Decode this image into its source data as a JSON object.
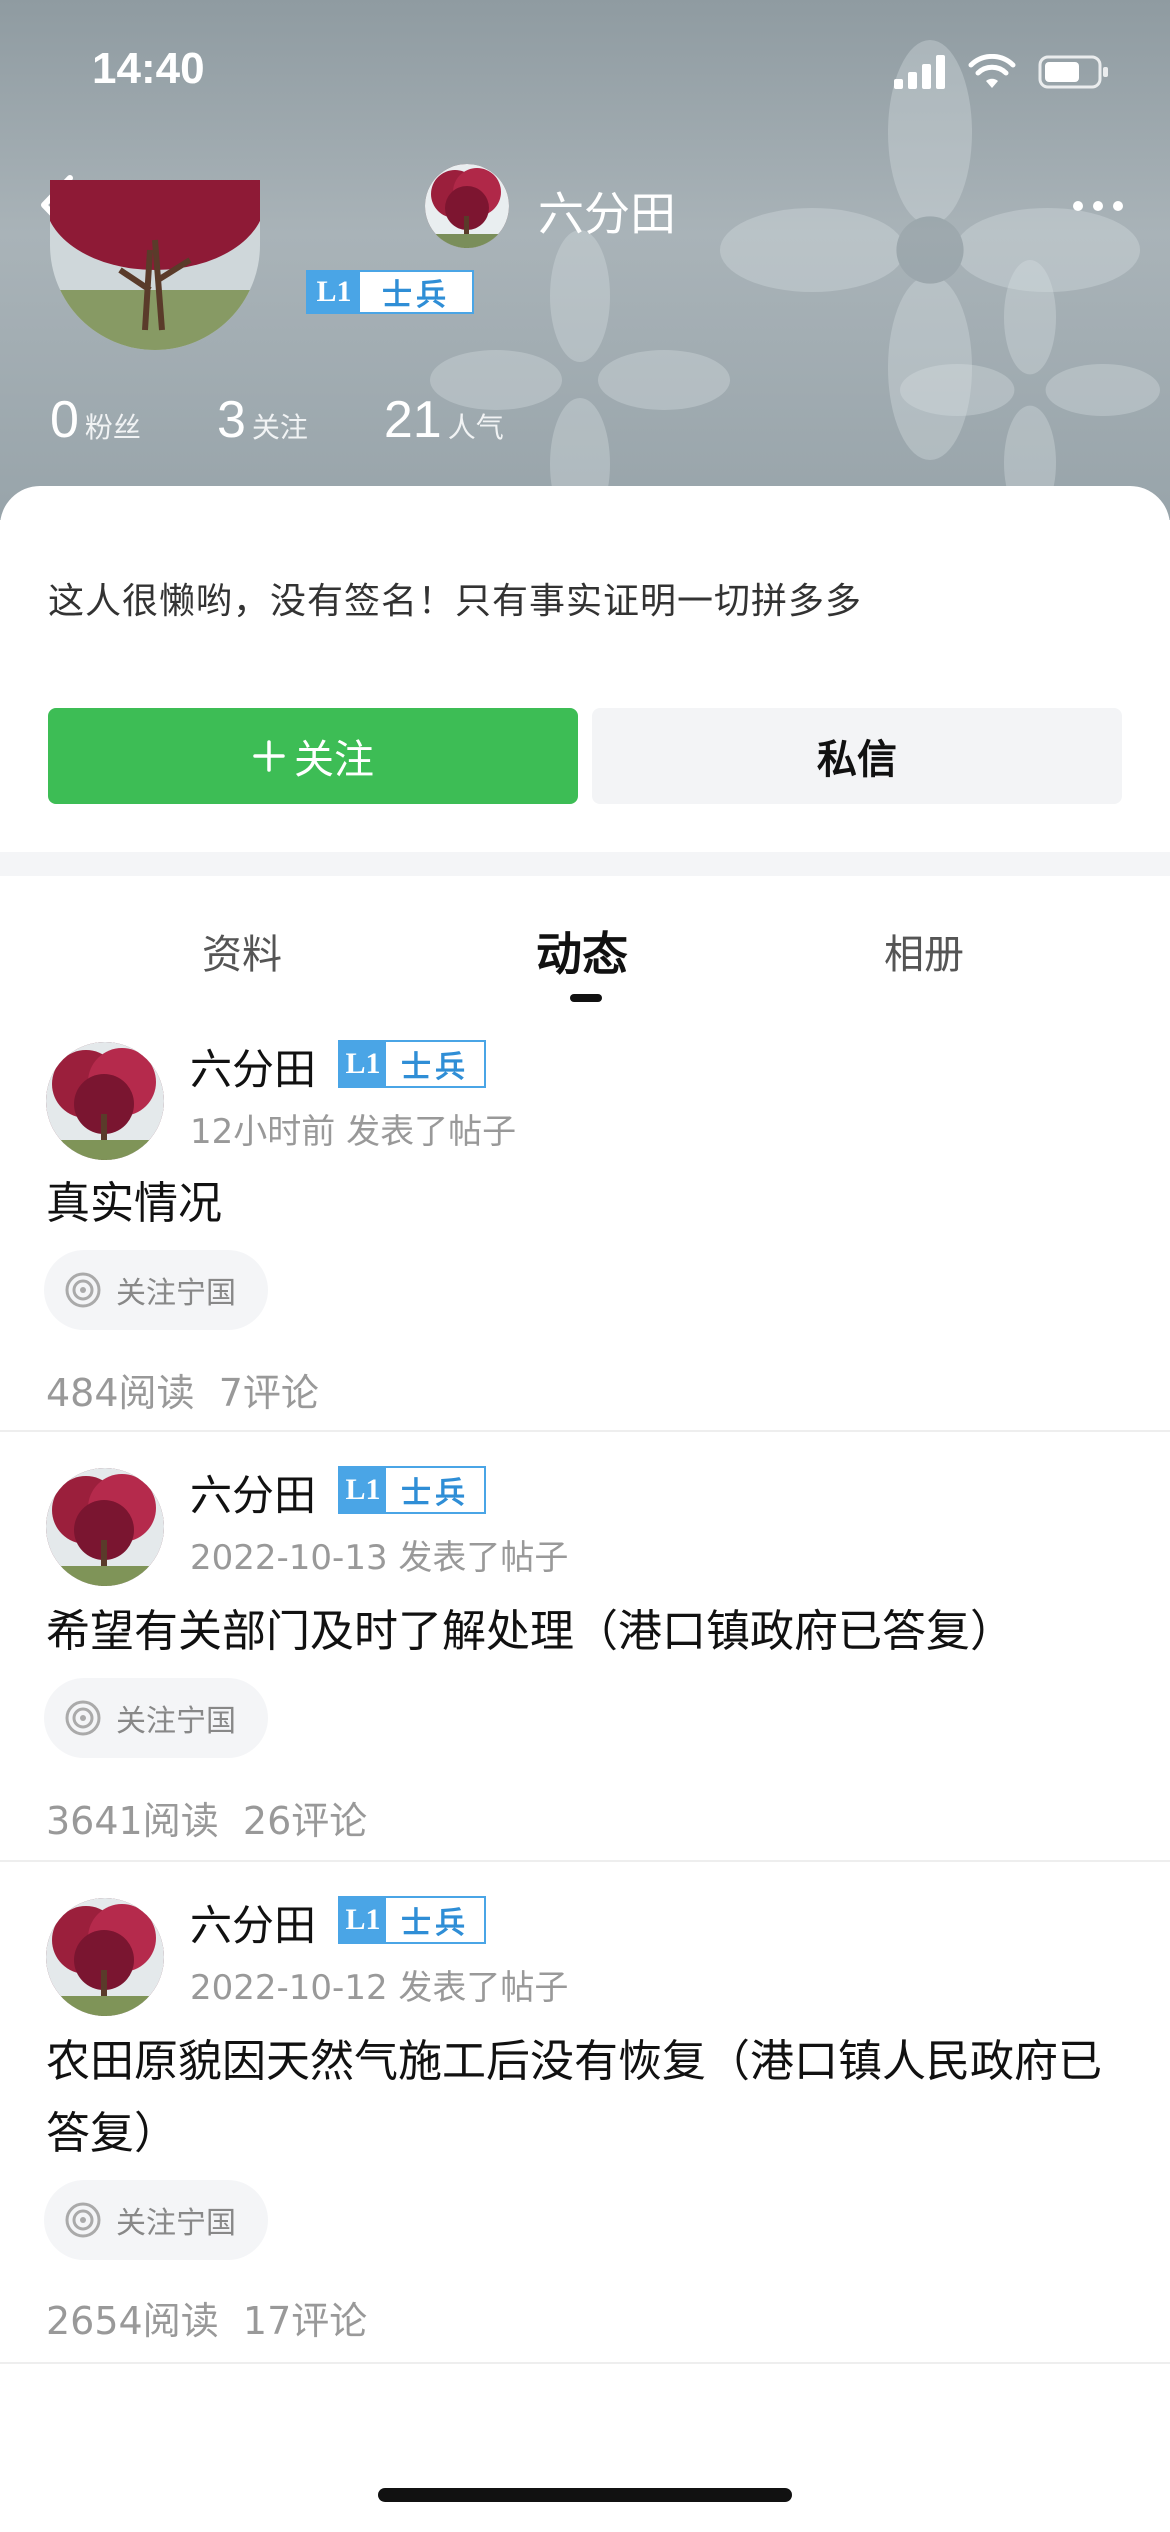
{
  "status_bar": {
    "time": "14:40"
  },
  "nav": {
    "title": "六分田"
  },
  "profile": {
    "level_code": "L1",
    "level_title": "士兵",
    "stats": [
      {
        "value": "0",
        "label": "粉丝"
      },
      {
        "value": "3",
        "label": "关注"
      },
      {
        "value": "21",
        "label": "人气"
      }
    ],
    "signature": "这人很懒哟，没有签名！只有事实证明一切拼多多"
  },
  "actions": {
    "follow_label": "关注",
    "message_label": "私信"
  },
  "tabs": [
    {
      "label": "资料"
    },
    {
      "label": "动态",
      "active": true
    },
    {
      "label": "相册"
    }
  ],
  "posts": [
    {
      "author": "六分田",
      "level_code": "L1",
      "level_title": "士兵",
      "meta": "12小时前 发表了帖子",
      "title": "真实情况",
      "tag": "关注宁国",
      "reads": "484阅读",
      "comments": "7评论"
    },
    {
      "author": "六分田",
      "level_code": "L1",
      "level_title": "士兵",
      "meta": "2022-10-13 发表了帖子",
      "title": "希望有关部门及时了解处理（港口镇政府已答复）",
      "tag": "关注宁国",
      "reads": "3641阅读",
      "comments": "26评论"
    },
    {
      "author": "六分田",
      "level_code": "L1",
      "level_title": "士兵",
      "meta": "2022-10-12 发表了帖子",
      "title": "农田原貌因天然气施工后没有恢复（港口镇人民政府已答复）",
      "tag": "关注宁国",
      "reads": "2654阅读",
      "comments": "17评论"
    }
  ],
  "colors": {
    "follow_green": "#3dbd55",
    "level_blue": "#4aa5e6"
  }
}
